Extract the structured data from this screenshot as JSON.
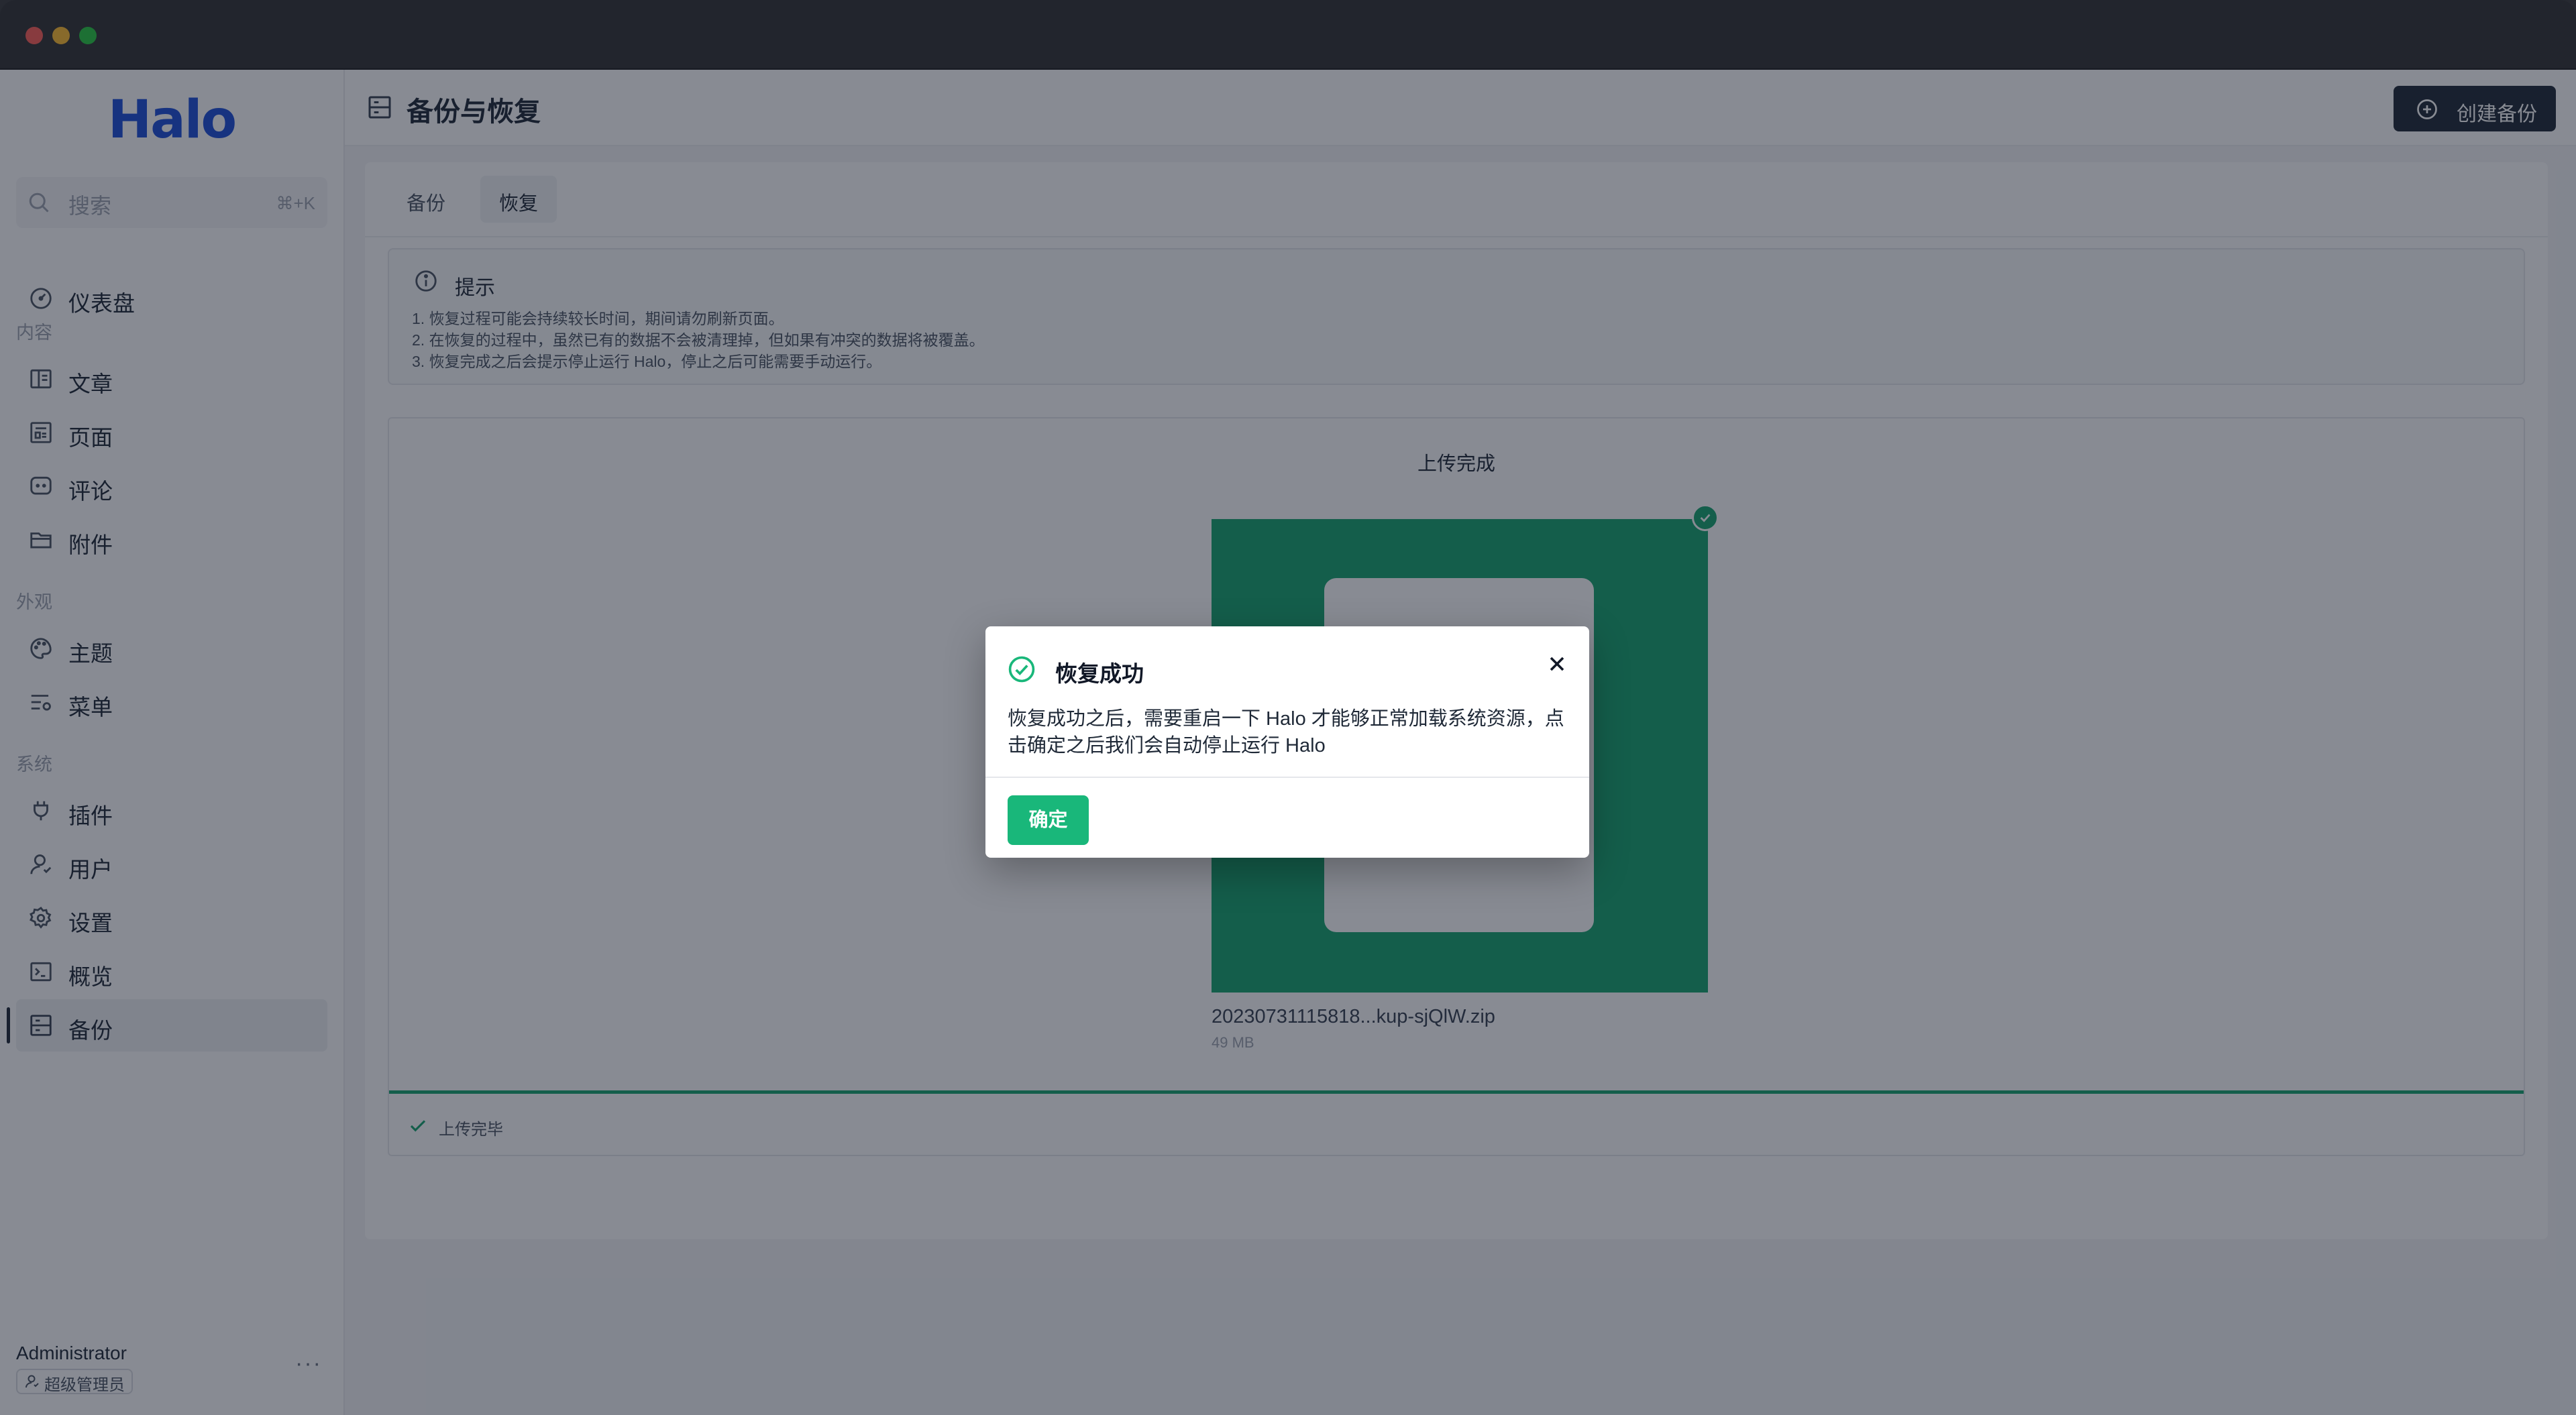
{
  "window": {
    "traffic_lights": [
      "close",
      "minimize",
      "zoom"
    ]
  },
  "sidebar": {
    "logo": "Halo",
    "search": {
      "placeholder": "搜索",
      "shortcut": "⌘+K"
    },
    "items": [
      {
        "label": "仪表盘",
        "icon": "dashboard-icon"
      },
      {
        "group": "内容"
      },
      {
        "label": "文章",
        "icon": "book-icon"
      },
      {
        "label": "页面",
        "icon": "page-icon"
      },
      {
        "label": "评论",
        "icon": "comment-icon"
      },
      {
        "label": "附件",
        "icon": "folder-icon"
      },
      {
        "group": "外观"
      },
      {
        "label": "主题",
        "icon": "palette-icon"
      },
      {
        "label": "菜单",
        "icon": "menu-settings-icon"
      },
      {
        "group": "系统"
      },
      {
        "label": "插件",
        "icon": "plug-icon"
      },
      {
        "label": "用户",
        "icon": "user-icon"
      },
      {
        "label": "设置",
        "icon": "gear-icon"
      },
      {
        "label": "概览",
        "icon": "terminal-icon"
      },
      {
        "label": "备份",
        "icon": "server-icon",
        "active": true
      }
    ],
    "user": {
      "name": "Administrator",
      "role": "超级管理员",
      "more": "···"
    }
  },
  "header": {
    "title": "备份与恢复",
    "create_button": "创建备份"
  },
  "tabs": [
    {
      "label": "备份",
      "active": false
    },
    {
      "label": "恢复",
      "active": true
    }
  ],
  "alert": {
    "title": "提示",
    "lines": [
      "1. 恢复过程可能会持续较长时间，期间请勿刷新页面。",
      "2. 在恢复的过程中，虽然已有的数据不会被清理掉，但如果有冲突的数据将被覆盖。",
      "3. 恢复完成之后会提示停止运行 Halo，停止之后可能需要手动运行。"
    ]
  },
  "uploader": {
    "title": "上传完成",
    "file_name": "20230731115818...kup-sjQlW.zip",
    "file_size": "49 MB",
    "progress": 1.0,
    "status": "上传完毕"
  },
  "modal": {
    "title": "恢复成功",
    "body": "恢复成功之后，需要重启一下 Halo 才能够正常加载系统资源，点击确定之后我们会自动停止运行 Halo",
    "ok": "确定"
  },
  "colors": {
    "accent": "#19b77a",
    "primary_dark": "#1f2937",
    "overlay": "rgba(17,24,39,0.5)"
  }
}
